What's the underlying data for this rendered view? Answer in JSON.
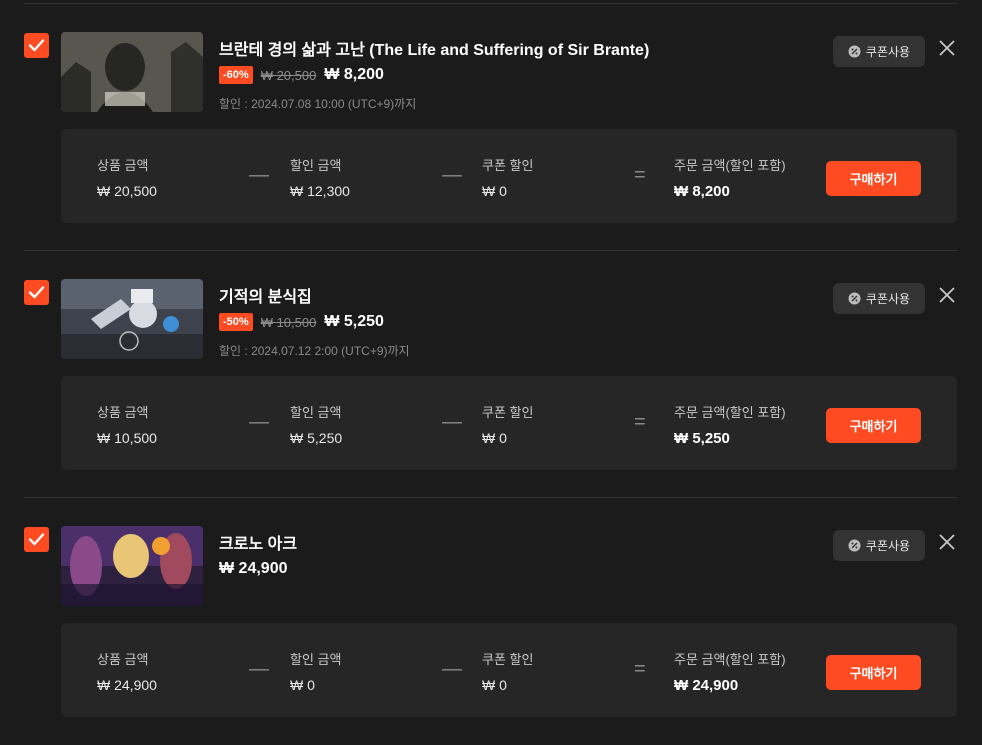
{
  "items": [
    {
      "title": "브란테 경의 삶과 고난 (The Life and Suffering of Sir Brante)",
      "discount_badge": "-60%",
      "original_price": "₩ 20,500",
      "final_price": "₩ 8,200",
      "discount_period": "할인 : 2024.07.08 10:00 (UTC+9)까지",
      "coupon_label": "쿠폰사용",
      "summary": {
        "product_label": "상품 금액",
        "product_value": "₩ 20,500",
        "discount_label": "할인 금액",
        "discount_value": "₩ 12,300",
        "coupon_label": "쿠폰 할인",
        "coupon_value": "₩ 0",
        "total_label": "주문 금액(할인 포함)",
        "total_value": "₩ 8,200",
        "buy_label": "구매하기"
      },
      "thumb_colors": [
        "#5a5a55",
        "#262624"
      ]
    },
    {
      "title": "기적의 분식집",
      "discount_badge": "-50%",
      "original_price": "₩ 10,500",
      "final_price": "₩ 5,250",
      "discount_period": "할인 : 2024.07.12 2:00 (UTC+9)까지",
      "coupon_label": "쿠폰사용",
      "summary": {
        "product_label": "상품 금액",
        "product_value": "₩ 10,500",
        "discount_label": "할인 금액",
        "discount_value": "₩ 5,250",
        "coupon_label": "쿠폰 할인",
        "coupon_value": "₩ 0",
        "total_label": "주문 금액(할인 포함)",
        "total_value": "₩ 5,250",
        "buy_label": "구매하기"
      },
      "thumb_colors": [
        "#7a8494",
        "#353a44"
      ]
    },
    {
      "title": "크로노 아크",
      "final_price": "₩ 24,900",
      "coupon_label": "쿠폰사용",
      "summary": {
        "product_label": "상품 금액",
        "product_value": "₩ 24,900",
        "discount_label": "할인 금액",
        "discount_value": "₩ 0",
        "coupon_label": "쿠폰 할인",
        "coupon_value": "₩ 0",
        "total_label": "주문 금액(할인 포함)",
        "total_value": "₩ 24,900",
        "buy_label": "구매하기"
      },
      "thumb_colors": [
        "#3d2a5e",
        "#7a3560"
      ]
    }
  ],
  "colors": {
    "accent": "#ff4b22",
    "background": "#1b1b1b",
    "panel": "#262626"
  },
  "icons": {
    "checkbox": "checkmark-icon",
    "coupon": "coupon-icon",
    "remove": "close-icon"
  },
  "operators": {
    "minus": "—",
    "equals": "="
  }
}
